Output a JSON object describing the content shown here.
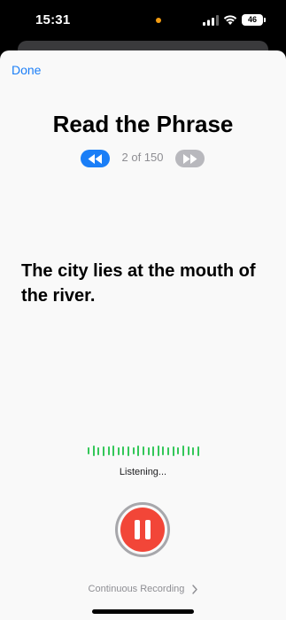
{
  "status_bar": {
    "time": "15:31",
    "battery": "46"
  },
  "header": {
    "done_label": "Done",
    "title": "Read the Phrase",
    "counter": "2 of 150"
  },
  "phrase": "The city lies at the mouth of the river.",
  "recording": {
    "status": "Listening...",
    "continuous_label": "Continuous Recording"
  },
  "colors": {
    "accent": "#1a7ef7",
    "record": "#f24638",
    "waveform": "#34c759"
  },
  "icons": {
    "prev": "rewind-icon",
    "next": "fast-forward-icon",
    "record": "pause-icon",
    "chevron": "chevron-right-icon"
  }
}
